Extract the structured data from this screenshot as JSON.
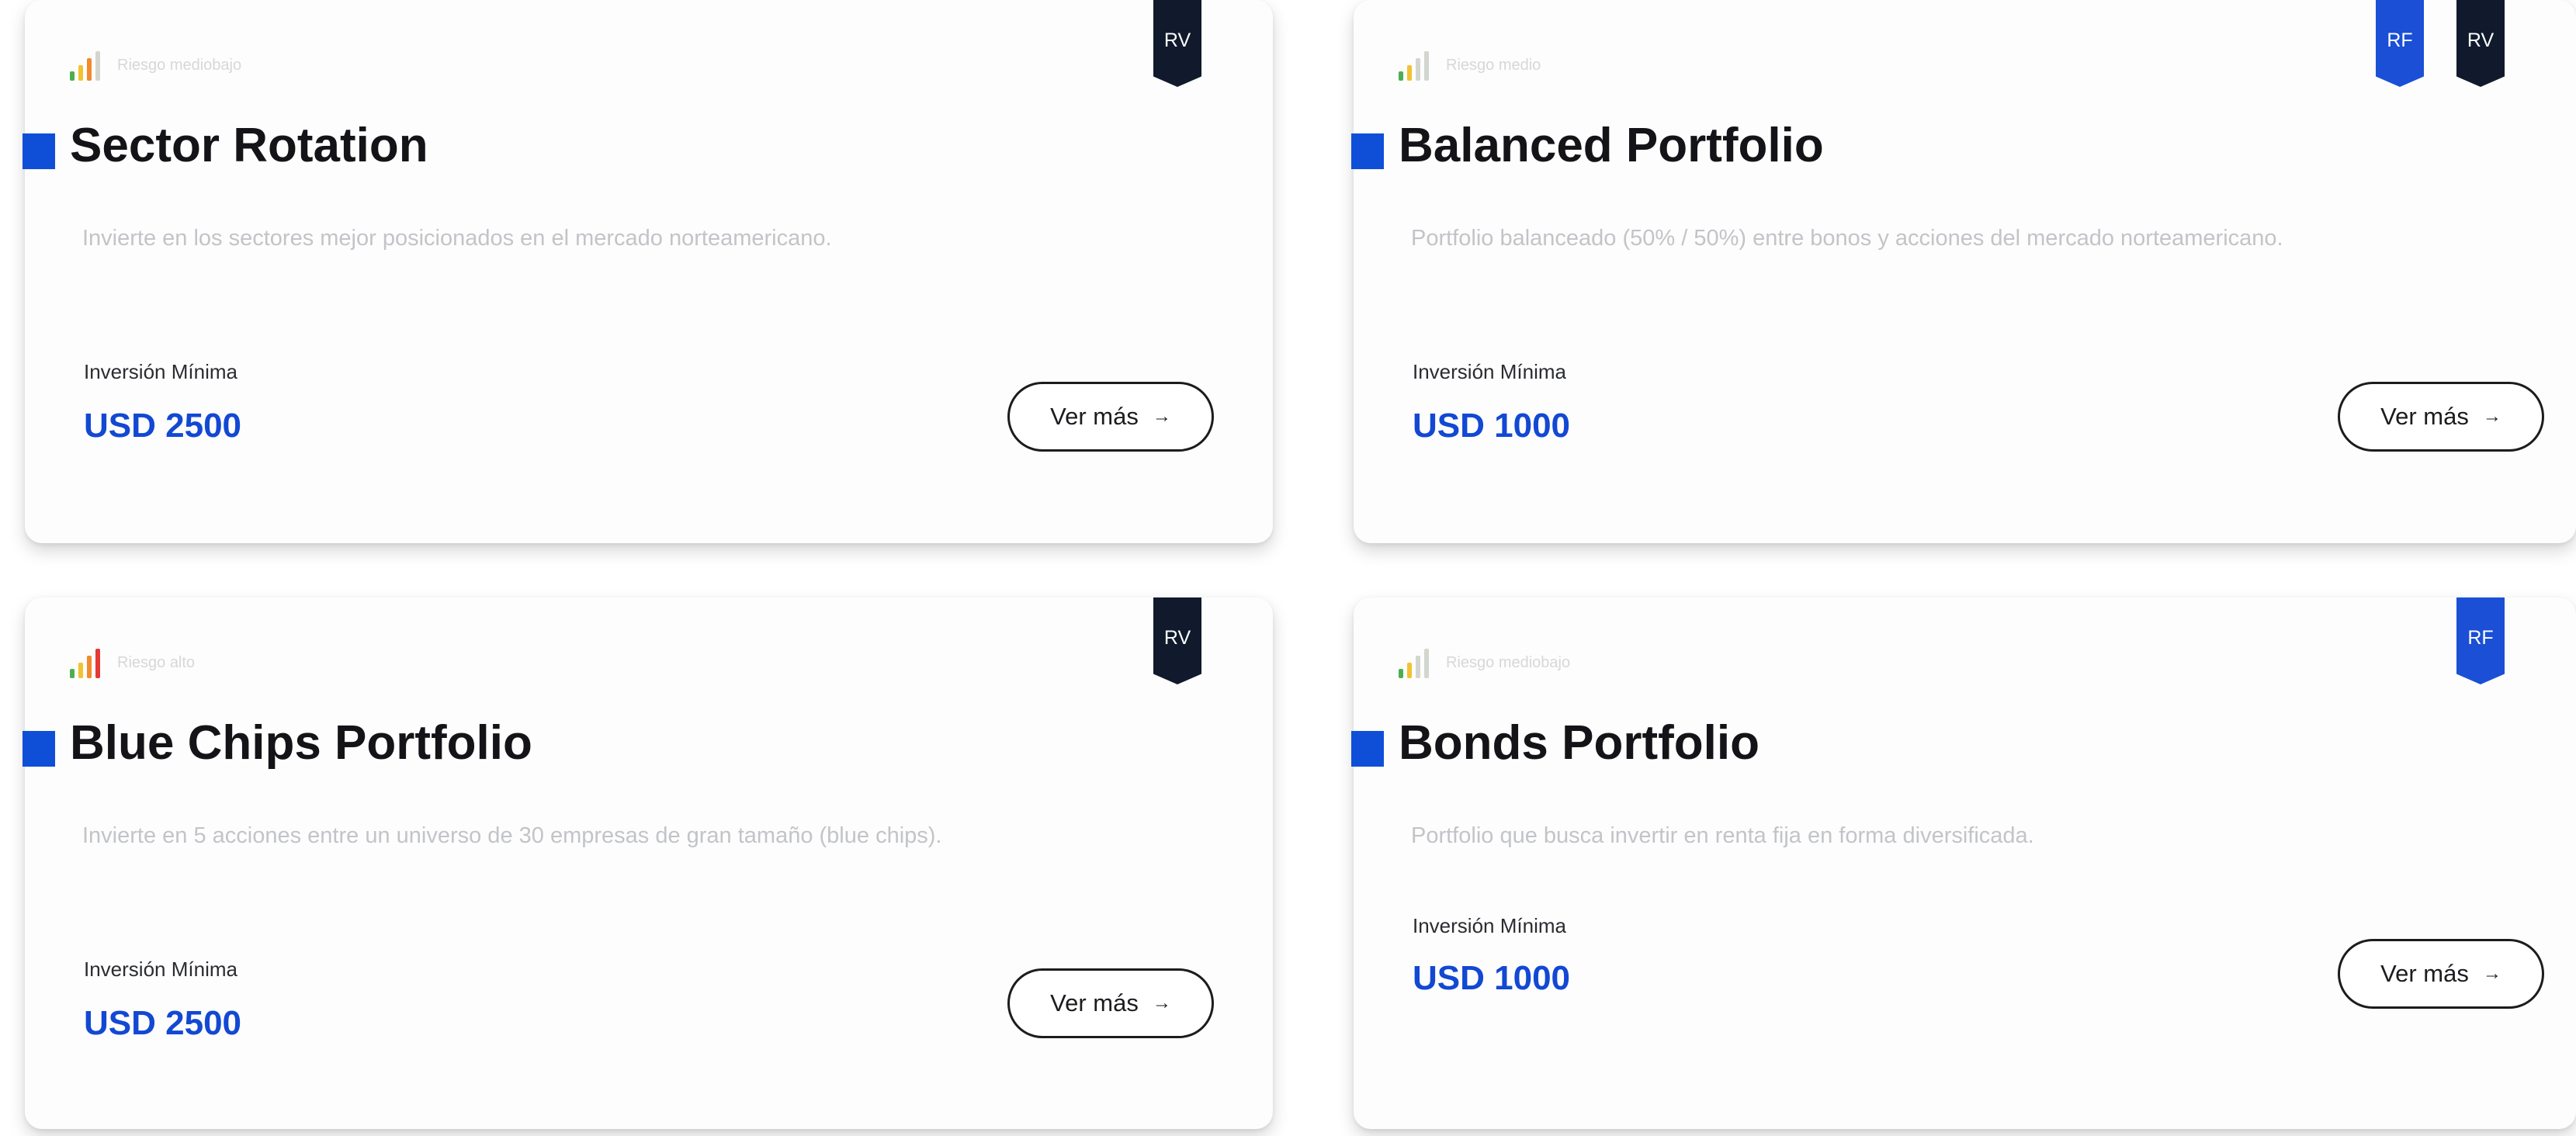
{
  "cards": [
    {
      "risk": "Riesgo mediobajo",
      "tags": [
        "RV"
      ],
      "title": "Sector Rotation",
      "description": "Invierte en los sectores mejor posicionados en el mercado norteamericano.",
      "investment_label": "Inversión Mínima",
      "investment_value": "USD 2500",
      "button_label": "Ver más",
      "arrow": "→"
    },
    {
      "risk": "Riesgo medio",
      "tags": [
        "RF",
        "RV"
      ],
      "title": "Balanced Portfolio",
      "description": "Portfolio balanceado (50% / 50%) entre bonos y acciones del mercado norteamericano.",
      "investment_label": "Inversión Mínima",
      "investment_value": "USD 1000",
      "button_label": "Ver más",
      "arrow": "→"
    },
    {
      "risk": "Riesgo alto",
      "tags": [
        "RV"
      ],
      "title": "Blue Chips Portfolio",
      "description": "Invierte en 5 acciones entre un universo de 30 empresas de gran tamaño (blue chips).",
      "investment_label": "Inversión Mínima",
      "investment_value": "USD 2500",
      "button_label": "Ver más",
      "arrow": "→"
    },
    {
      "risk": "Riesgo mediobajo",
      "tags": [
        "RF"
      ],
      "title": "Bonds Portfolio",
      "description": "Portfolio que busca invertir en renta fija en forma diversificada.",
      "investment_label": "Inversión Mínima",
      "investment_value": "USD 1000",
      "button_label": "Ver más",
      "arrow": "→"
    }
  ],
  "colors": {
    "accent": "#0f4fd8",
    "tag_rv": "#101a2c",
    "tag_rf": "#1a4fd6",
    "risk_green": "#4caf50",
    "risk_yellow": "#f2c230",
    "risk_orange": "#f28a2e",
    "risk_red": "#e53935"
  }
}
